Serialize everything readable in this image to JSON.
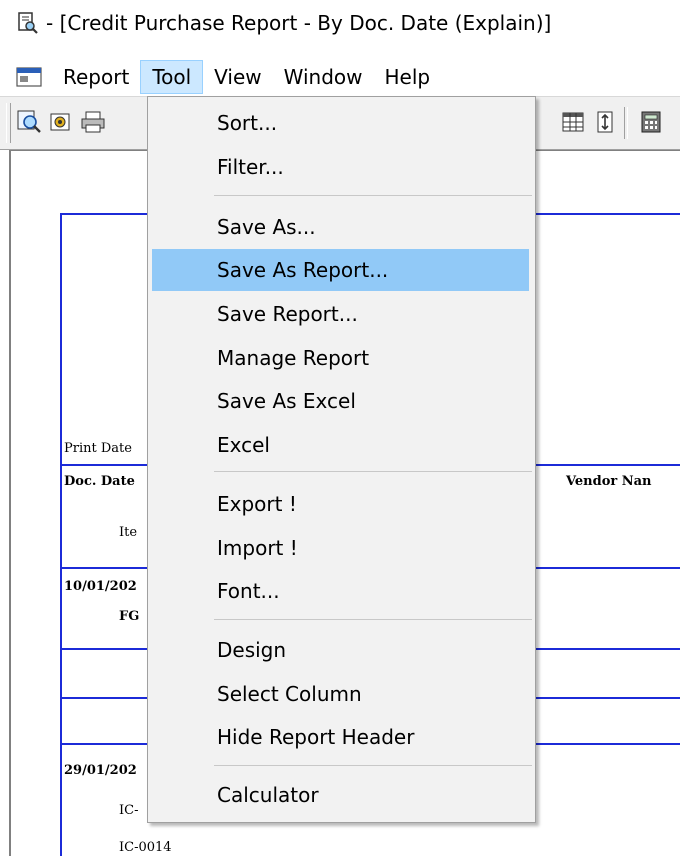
{
  "window": {
    "title": "- [Credit  Purchase  Report - By  Doc. Date (Explain)]"
  },
  "menubar": {
    "items": [
      "Report",
      "Tool",
      "View",
      "Window",
      "Help"
    ],
    "active": "Tool"
  },
  "tool_menu": {
    "items": [
      "Sort...",
      "Filter...",
      "Save As...",
      "Save As Report...",
      "Save Report...",
      "Manage Report",
      "Save As Excel",
      "Excel",
      "Export !",
      "Import !",
      "Font...",
      "Design",
      "Select Column",
      "Hide Report Header",
      "Calculator"
    ],
    "highlighted": "Save As Report..."
  },
  "report": {
    "print_date_label": "Print Date",
    "col_doc_date": "Doc. Date",
    "col_vendor_name": "Vendor Nan",
    "col_item": "Ite",
    "rows": [
      {
        "date": "10/01/202",
        "item": "FG"
      },
      {
        "date": "29/01/202",
        "item": "IC-"
      },
      {
        "item": "IC-0014"
      }
    ]
  },
  "colors": {
    "accent_highlight": "#91c9f7",
    "menu_active": "#cce8ff",
    "report_line": "#1c2bd8"
  }
}
